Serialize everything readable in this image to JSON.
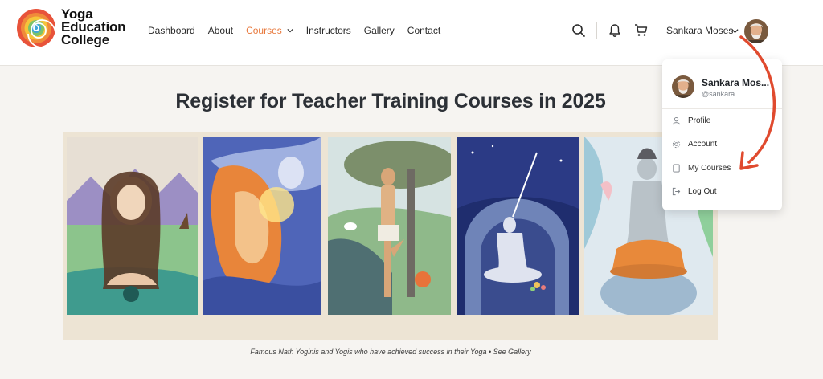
{
  "brand": {
    "line1": "Yoga",
    "line2": "Education",
    "line3": "College"
  },
  "nav": {
    "items": [
      {
        "label": "Dashboard"
      },
      {
        "label": "About"
      },
      {
        "label": "Courses"
      },
      {
        "label": "Instructors"
      },
      {
        "label": "Gallery"
      },
      {
        "label": "Contact"
      }
    ]
  },
  "user": {
    "name": "Sankara Moses",
    "dropdown_name": "Sankara Mos...",
    "handle": "@sankara"
  },
  "dropdown": {
    "items": [
      {
        "label": "Profile",
        "icon": "user-icon"
      },
      {
        "label": "Account",
        "icon": "gear-icon"
      },
      {
        "label": "My Courses",
        "icon": "book-icon"
      },
      {
        "label": "Log Out",
        "icon": "logout-icon"
      }
    ]
  },
  "main": {
    "title": "Register for Teacher Training Courses in 2025",
    "caption": "Famous Nath Yoginis and Yogis who have achieved success in their Yoga • See Gallery"
  },
  "colors": {
    "accent": "#e8773a",
    "arrow": "#e04a2e"
  }
}
